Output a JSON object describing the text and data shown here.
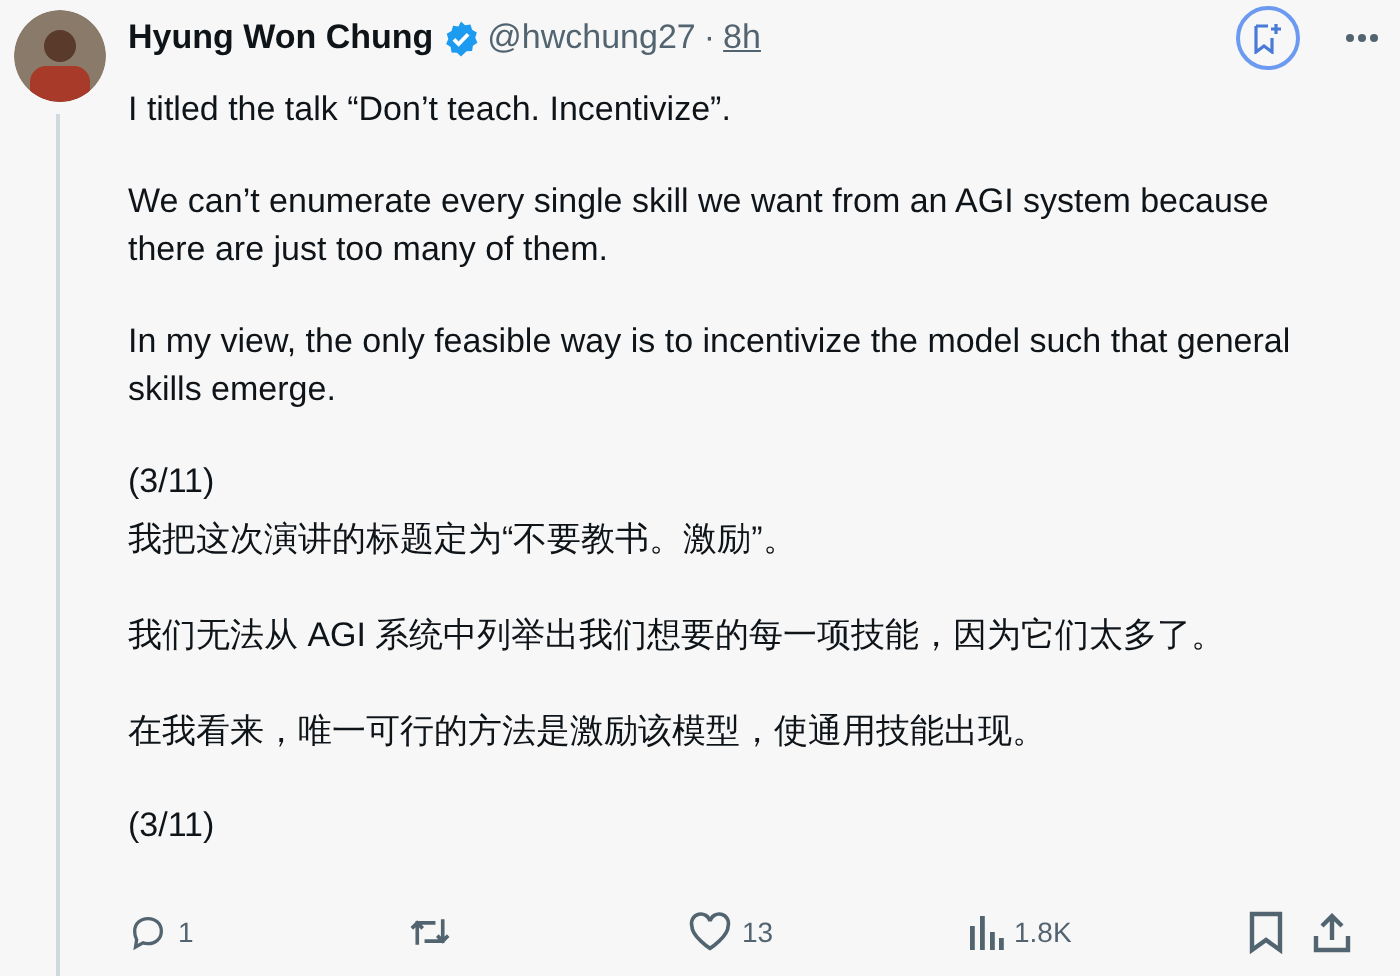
{
  "author": {
    "name": "Hyung Won Chung",
    "verified": true,
    "handle": "@hwchung27",
    "separator": "·",
    "time": "8h"
  },
  "body": [
    [
      "I titled the talk “Don’t teach. Incentivize”."
    ],
    [
      "We can’t enumerate every single skill we want from an AGI system because there are just too many of them."
    ],
    [
      "In my view, the only feasible way is to incentivize the model such that general skills emerge."
    ],
    [
      "(3/11)",
      "我把这次演讲的标题定为“不要教书。激励”。"
    ],
    [
      "我们无法从 AGI 系统中列举出我们想要的每一项技能，因为它们太多了。"
    ],
    [
      "在我看来，唯一可行的方法是激励该模型，使通用技能出现。"
    ],
    [
      "(3/11)"
    ]
  ],
  "actions": [
    {
      "kind": "reply",
      "count": "1"
    },
    {
      "kind": "repost"
    },
    {
      "kind": "like",
      "count": "13"
    },
    {
      "kind": "views",
      "count": "1.8K"
    },
    {
      "kind": "bookmark"
    },
    {
      "kind": "share"
    }
  ]
}
